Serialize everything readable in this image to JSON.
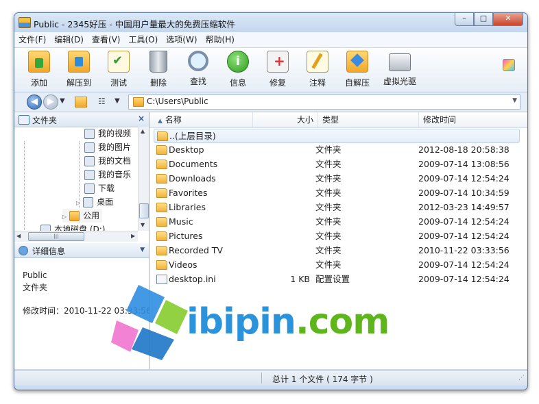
{
  "window": {
    "title": "Public - 2345好压 - 中国用户量最大的免费压缩软件",
    "controls": {
      "minimize": "–",
      "maximize": "□",
      "close": "✕"
    }
  },
  "menu": [
    "文件(F)",
    "编辑(D)",
    "查看(V)",
    "工具(O)",
    "选项(W)",
    "帮助(H)"
  ],
  "toolbar": [
    {
      "label": "添加",
      "icon": "add-archive-icon"
    },
    {
      "label": "解压到",
      "icon": "extract-to-icon"
    },
    {
      "label": "测试",
      "icon": "test-icon"
    },
    {
      "label": "删除",
      "icon": "trash-icon"
    },
    {
      "label": "查找",
      "icon": "search-icon"
    },
    {
      "label": "信息",
      "icon": "info-icon"
    },
    {
      "label": "修复",
      "icon": "repair-kit-icon"
    },
    {
      "label": "注释",
      "icon": "comment-icon"
    },
    {
      "label": "自解压",
      "icon": "sfx-icon"
    },
    {
      "label": "虚拟光驱",
      "icon": "virtual-drive-icon"
    }
  ],
  "address": {
    "path": "C:\\Users\\Public"
  },
  "left_panel": {
    "folders_title": "文件夹",
    "folders_close": "×",
    "tree": [
      "我的视频",
      "我的图片",
      "我的文档",
      "我的音乐",
      "下载",
      "桌面",
      "公用",
      "本地磁盘 (D:)"
    ],
    "details_title": "详细信息",
    "details": {
      "name": "Public",
      "type": "文件夹",
      "modified": "修改时间：2010-11-22 03:33:56"
    }
  },
  "columns": {
    "name": "名称",
    "size": "大小",
    "type": "类型",
    "date": "修改时间"
  },
  "parent_row": "..(上层目录)",
  "rows": [
    {
      "name": "Desktop",
      "size": "",
      "type": "文件夹",
      "date": "2012-08-18 20:58:38"
    },
    {
      "name": "Documents",
      "size": "",
      "type": "文件夹",
      "date": "2009-07-14 13:08:56"
    },
    {
      "name": "Downloads",
      "size": "",
      "type": "文件夹",
      "date": "2009-07-14 12:54:24"
    },
    {
      "name": "Favorites",
      "size": "",
      "type": "文件夹",
      "date": "2009-07-14 10:34:59"
    },
    {
      "name": "Libraries",
      "size": "",
      "type": "文件夹",
      "date": "2012-03-23 14:49:57"
    },
    {
      "name": "Music",
      "size": "",
      "type": "文件夹",
      "date": "2009-07-14 12:54:24"
    },
    {
      "name": "Pictures",
      "size": "",
      "type": "文件夹",
      "date": "2009-07-14 12:54:24"
    },
    {
      "name": "Recorded TV",
      "size": "",
      "type": "文件夹",
      "date": "2010-11-22 03:33:56"
    },
    {
      "name": "Videos",
      "size": "",
      "type": "文件夹",
      "date": "2009-07-14 12:54:24"
    },
    {
      "name": "desktop.ini",
      "size": "1 KB",
      "type": "配置设置",
      "date": "2009-07-14 12:54:24"
    }
  ],
  "status": "总计 1 个文件 ( 174 字节 )",
  "watermark": {
    "a": "ibipin",
    "b": ".com"
  }
}
